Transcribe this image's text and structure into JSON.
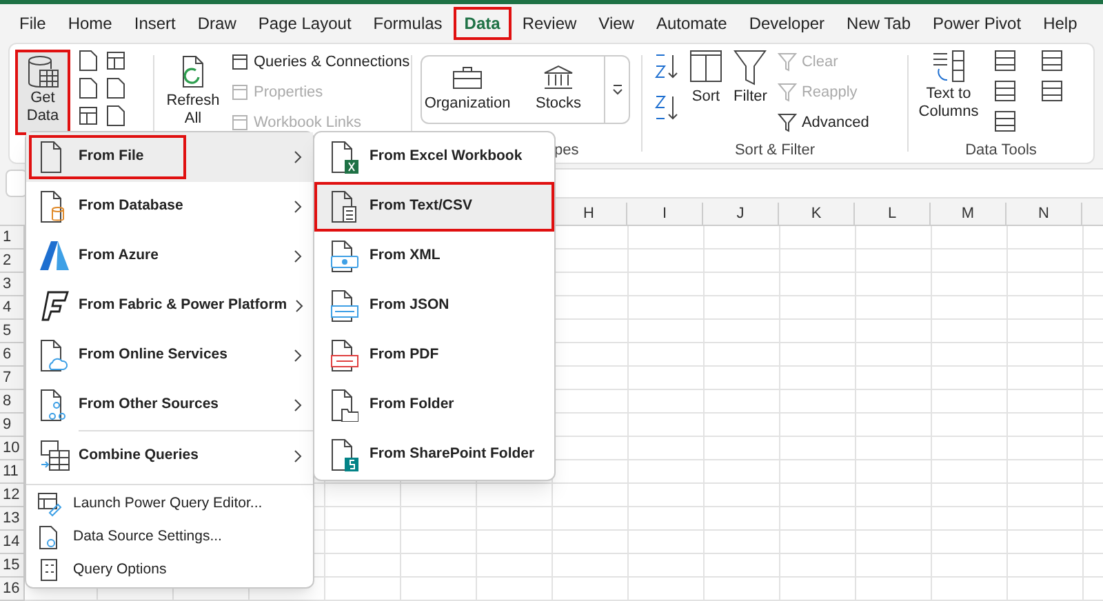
{
  "tabs": [
    {
      "label": "File",
      "selected": false,
      "highlighted": false
    },
    {
      "label": "Home",
      "selected": false,
      "highlighted": false
    },
    {
      "label": "Insert",
      "selected": false,
      "highlighted": false
    },
    {
      "label": "Draw",
      "selected": false,
      "highlighted": false
    },
    {
      "label": "Page Layout",
      "selected": false,
      "highlighted": false
    },
    {
      "label": "Formulas",
      "selected": false,
      "highlighted": false
    },
    {
      "label": "Data",
      "selected": true,
      "highlighted": true
    },
    {
      "label": "Review",
      "selected": false,
      "highlighted": false
    },
    {
      "label": "View",
      "selected": false,
      "highlighted": false
    },
    {
      "label": "Automate",
      "selected": false,
      "highlighted": false
    },
    {
      "label": "Developer",
      "selected": false,
      "highlighted": false
    },
    {
      "label": "New Tab",
      "selected": false,
      "highlighted": false
    },
    {
      "label": "Power Pivot",
      "selected": false,
      "highlighted": false
    },
    {
      "label": "Help",
      "selected": false,
      "highlighted": false
    }
  ],
  "ribbon": {
    "get_data": {
      "line1": "Get",
      "line2": "Data",
      "highlighted": true
    },
    "refresh": {
      "line1": "Refresh",
      "line2": "All"
    },
    "queries": [
      {
        "label": "Queries & Connections",
        "disabled": false
      },
      {
        "label": "Properties",
        "disabled": true
      },
      {
        "label": "Workbook Links",
        "disabled": true
      }
    ],
    "data_types": [
      {
        "label": "Organization"
      },
      {
        "label": "Stocks"
      }
    ],
    "data_types_label": "pes",
    "sort_label": "Sort",
    "filter_label": "Filter",
    "filter_actions": [
      {
        "label": "Clear",
        "disabled": true
      },
      {
        "label": "Reapply",
        "disabled": true
      },
      {
        "label": "Advanced",
        "disabled": false
      }
    ],
    "sort_filter_label": "Sort & Filter",
    "text_to_columns": {
      "line1": "Text to",
      "line2": "Columns"
    },
    "data_tools_label": "Data Tools"
  },
  "columns": [
    "H",
    "I",
    "J",
    "K",
    "L",
    "M",
    "N"
  ],
  "rows": [
    "1",
    "2",
    "3",
    "4",
    "5",
    "6",
    "7",
    "8",
    "9",
    "10",
    "11",
    "12",
    "13",
    "14",
    "15",
    "16"
  ],
  "menu": {
    "items": [
      {
        "kind": "source",
        "label": "From File",
        "highlighted": true,
        "hovered": true
      },
      {
        "kind": "source",
        "label": "From Database",
        "highlighted": false,
        "hovered": false
      },
      {
        "kind": "source",
        "label": "From Azure",
        "highlighted": false,
        "hovered": false
      },
      {
        "kind": "source",
        "label": "From Fabric & Power Platform",
        "highlighted": false,
        "hovered": false
      },
      {
        "kind": "source",
        "label": "From Online Services",
        "highlighted": false,
        "hovered": false
      },
      {
        "kind": "source",
        "label": "From Other Sources",
        "highlighted": false,
        "hovered": false
      },
      {
        "kind": "source",
        "label": "Combine Queries",
        "highlighted": false,
        "hovered": false
      },
      {
        "kind": "command",
        "label": "Launch Power Query Editor..."
      },
      {
        "kind": "command",
        "label": "Data Source Settings..."
      },
      {
        "kind": "command",
        "label": "Query Options"
      }
    ]
  },
  "submenu": {
    "items": [
      {
        "label": "From Excel Workbook",
        "highlighted": false
      },
      {
        "label": "From Text/CSV",
        "highlighted": true
      },
      {
        "label": "From XML",
        "highlighted": false
      },
      {
        "label": "From JSON",
        "highlighted": false
      },
      {
        "label": "From PDF",
        "highlighted": false
      },
      {
        "label": "From Folder",
        "highlighted": false
      },
      {
        "label": "From SharePoint Folder",
        "highlighted": false
      }
    ]
  }
}
